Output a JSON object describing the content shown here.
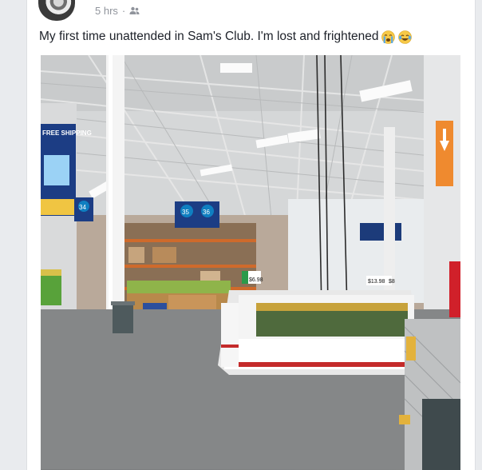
{
  "post": {
    "timestamp": "5 hrs",
    "separator": "·",
    "audience_icon": "friends-icon",
    "text": "My first time unattended in Sam's Club.  I'm lost and frightened",
    "emojis": [
      "crying-face-emoji",
      "tears-of-joy-emoji"
    ]
  },
  "photo": {
    "banner_text": "FREE SHIPPING",
    "aisle_signs": [
      "34",
      "35",
      "36"
    ],
    "price_tags": [
      "$6.98",
      "$13.98",
      "$8"
    ]
  },
  "colors": {
    "page_bg": "#e9ebee",
    "card_bg": "#ffffff",
    "meta_text": "#90949c",
    "body_text": "#1d2129"
  }
}
